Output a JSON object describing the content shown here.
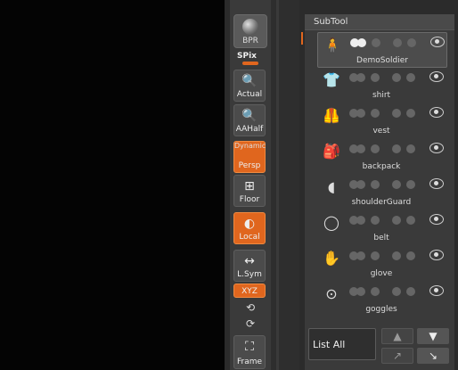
{
  "shelf": {
    "bpr_label": "BPR",
    "spix_label": "SPix",
    "buttons": [
      {
        "label": "Actual"
      },
      {
        "label": "AAHalf"
      },
      {
        "label": "Persp",
        "caption": "Dynamic"
      },
      {
        "label": "Floor"
      },
      {
        "label": "Local"
      },
      {
        "label": "L.Sym"
      },
      {
        "label": "XYZ"
      },
      {
        "label": "Frame"
      }
    ]
  },
  "subtool": {
    "title": "SubTool",
    "items": [
      {
        "name": "DemoSoldier",
        "icon": "figure-icon",
        "active": true
      },
      {
        "name": "shirt",
        "icon": "shirt-icon"
      },
      {
        "name": "vest",
        "icon": "vest-icon"
      },
      {
        "name": "backpack",
        "icon": "backpack-icon"
      },
      {
        "name": "shoulderGuard",
        "icon": "shoulderguard-icon"
      },
      {
        "name": "belt",
        "icon": "belt-icon"
      },
      {
        "name": "glove",
        "icon": "glove-icon"
      },
      {
        "name": "goggles",
        "icon": "goggles-icon"
      }
    ],
    "list_all_label": "List  All"
  },
  "colors": {
    "accent": "#e0661e",
    "model": "#9a2e1c"
  }
}
